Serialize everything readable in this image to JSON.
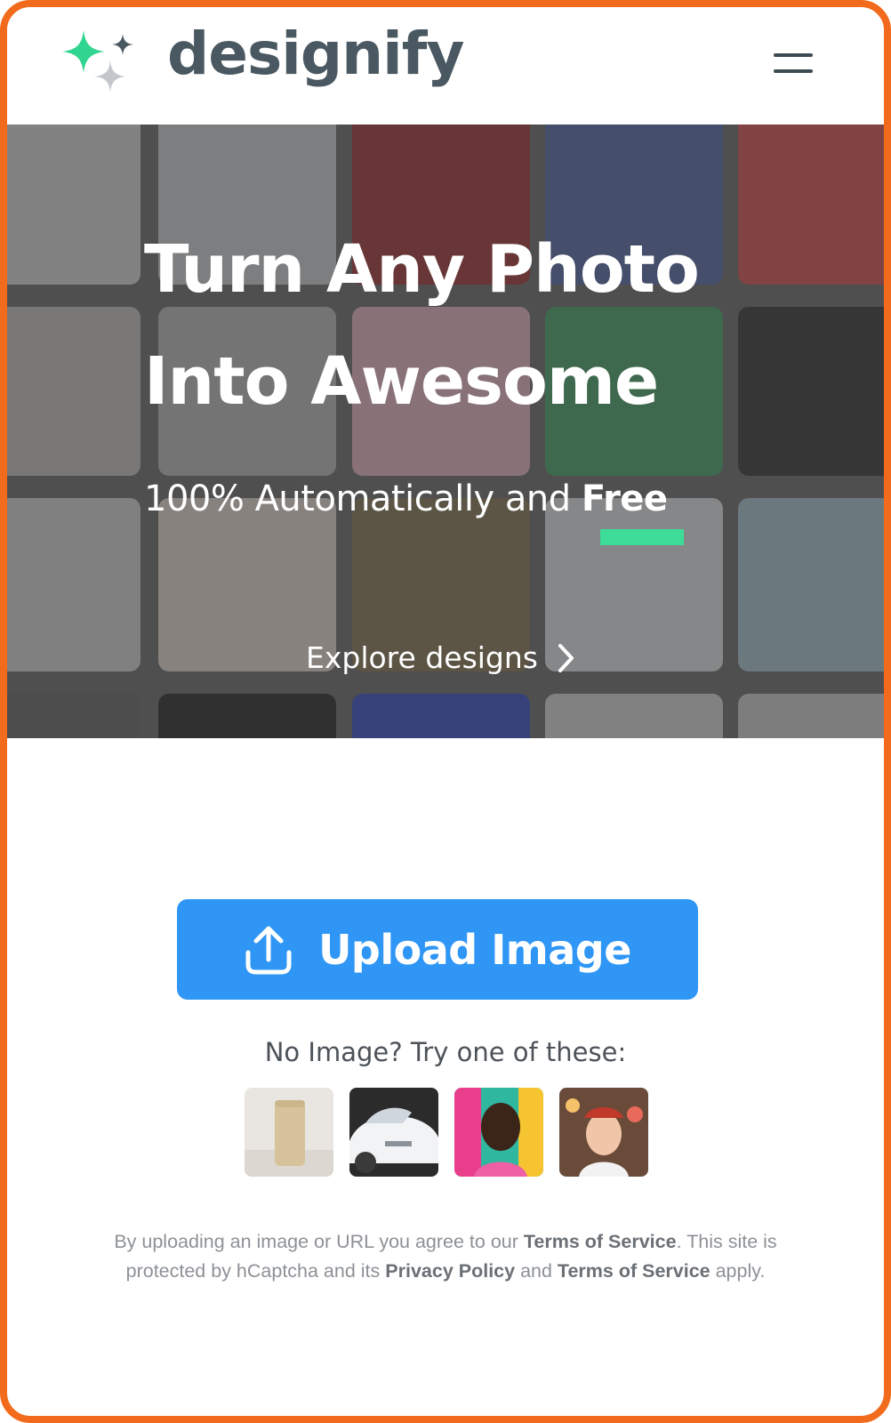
{
  "brand": {
    "name": "designify"
  },
  "hero": {
    "title_line1": "Turn Any Photo",
    "title_line2": "Into Awesome",
    "subtitle_prefix": "100% Automatically and ",
    "subtitle_highlight": "Free",
    "explore_label": "Explore designs",
    "accent_color": "#3ddc97"
  },
  "upload": {
    "button_label": "Upload Image",
    "button_color": "#2f96f5",
    "try_text": "No Image? Try one of these:"
  },
  "samples": [
    {
      "name": "sample-can"
    },
    {
      "name": "sample-car"
    },
    {
      "name": "sample-man"
    },
    {
      "name": "sample-woman"
    }
  ],
  "disclaimer": {
    "part1": "By uploading an image or URL you agree to our ",
    "link1": "Terms of Service",
    "part2": ". This site is protected by hCaptcha and its ",
    "link2": "Privacy Policy",
    "part3": " and ",
    "link3": "Terms of Service",
    "part4": " apply."
  },
  "colors": {
    "frame": "#f26a1b",
    "logo_green": "#2fd590",
    "logo_gray": "#4a5862"
  }
}
